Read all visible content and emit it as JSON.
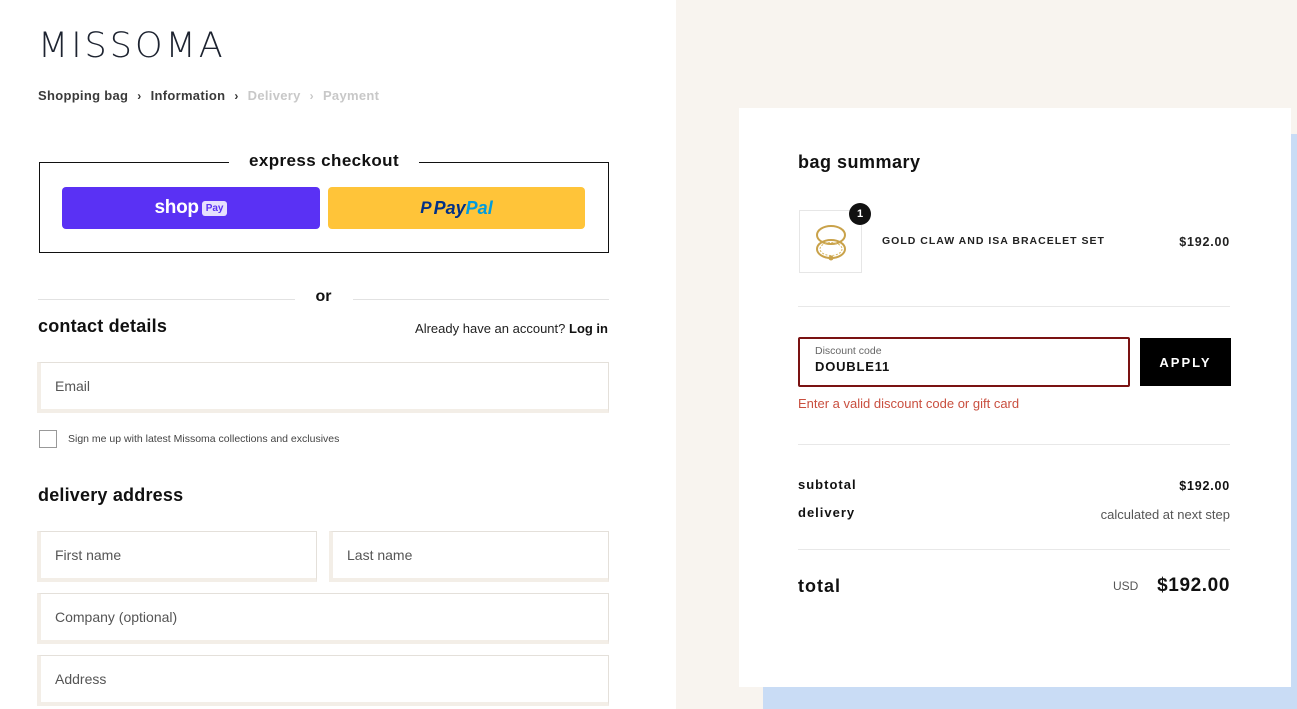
{
  "brand": {
    "logo": "MISSOMA"
  },
  "breadcrumb": {
    "items": [
      {
        "label": "Shopping bag",
        "state": "done"
      },
      {
        "label": "Information",
        "state": "current"
      },
      {
        "label": "Delivery",
        "state": "upcoming"
      },
      {
        "label": "Payment",
        "state": "upcoming"
      }
    ],
    "separator": "›"
  },
  "express": {
    "title": "express checkout",
    "shoppay": {
      "word": "shop",
      "badge": "Pay",
      "color": "#5a31f4"
    },
    "paypal": {
      "icon": "P",
      "word1": "Pay",
      "word2": "Pal",
      "color": "#ffc439"
    }
  },
  "or_label": "or",
  "contact": {
    "title": "contact details",
    "account_prompt": "Already have an account?",
    "login_label": "Log in",
    "email_placeholder": "Email",
    "newsletter_label": "Sign me up with latest Missoma collections and exclusives"
  },
  "delivery": {
    "title": "delivery address",
    "first_name": "First name",
    "last_name": "Last name",
    "company": "Company (optional)",
    "address": "Address"
  },
  "summary": {
    "title": "bag summary",
    "item": {
      "quantity": "1",
      "name": "GOLD CLAW AND ISA BRACELET SET",
      "price": "$192.00",
      "image_icon": "bracelet-icon"
    },
    "discount": {
      "label": "Discount code",
      "value": "DOUBLE11",
      "apply_label": "APPLY",
      "error": "Enter a valid discount code or gift card",
      "error_color": "#c94f3f"
    },
    "subtotal_label": "subtotal",
    "subtotal_value": "$192.00",
    "delivery_label": "delivery",
    "delivery_value": "calculated at next step",
    "total_label": "total",
    "total_currency": "USD",
    "total_value": "$192.00"
  },
  "colors": {
    "right_bg": "#f8f4ef",
    "accent_blue": "#c9dcf5"
  }
}
